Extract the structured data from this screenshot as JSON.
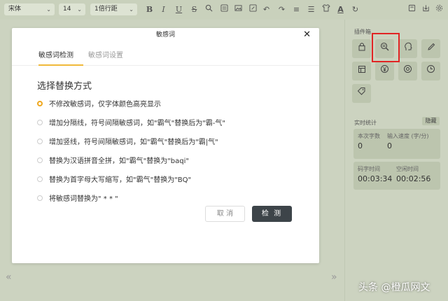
{
  "toolbar": {
    "font_family": "宋体",
    "font_size": "14",
    "line_spacing": "1倍行距",
    "icons": [
      "bold-icon",
      "italic-icon",
      "underline-icon",
      "strikethrough-icon",
      "search-icon",
      "list-icon",
      "image-icon",
      "link-icon",
      "copy-icon",
      "undo-icon",
      "redo-icon",
      "align-icon",
      "indent-icon",
      "shirt-icon",
      "font-color-icon",
      "refresh-icon",
      "save-icon",
      "download-icon",
      "settings-icon"
    ],
    "glyphs": {
      "bold": "B",
      "italic": "I",
      "underline": "U",
      "strike": "S",
      "font_color": "A"
    }
  },
  "modal": {
    "title": "敏感词",
    "close": "✕",
    "tabs": [
      "敏感词检测",
      "敏感词设置"
    ],
    "section_title": "选择替换方式",
    "options": [
      {
        "label": "不修改敏感词，仅字体颜色高亮显示",
        "selected": true
      },
      {
        "label": "增加分隔线，符号间隔敏感词，如\"霸气\"替换后为\"霸-气\"",
        "selected": false
      },
      {
        "label": "增加竖线，符号间隔敏感词，如\"霸气\"替换后为\"霸|气\"",
        "selected": false
      },
      {
        "label": "替换为汉语拼音全拼，如\"霸气\"替换为\"baqi\"",
        "selected": false
      },
      {
        "label": "替换为首字母大写缩写，如\"霸气\"替换为\"BQ\"",
        "selected": false
      },
      {
        "label": "将敏感词替换为\" * * \"",
        "selected": false
      }
    ],
    "cancel_label": "取 消",
    "detect_label": "检 测",
    "accent": "#f0a81e"
  },
  "panel": {
    "plugin_title": "插件箱",
    "plugins": [
      "lock-icon",
      "sensitive-word-search-icon",
      "head-icon",
      "pen-icon",
      "table-icon",
      "yen-icon",
      "at-icon",
      "clock-icon",
      "tag-icon"
    ],
    "stats_title": "实时统计",
    "hide_label": "隐藏",
    "stats": {
      "word_count_label": "本次字数",
      "word_count_value": "0",
      "input_speed_label": "输入速度 (字/分)",
      "input_speed_value": "0",
      "typing_time_label": "码字时间",
      "typing_time_value": "00:03:34",
      "idle_time_label": "空闲时间",
      "idle_time_value": "00:02:56"
    }
  },
  "nav": {
    "prev": "«",
    "next": "»"
  },
  "watermark": "头条 @橙瓜网文"
}
